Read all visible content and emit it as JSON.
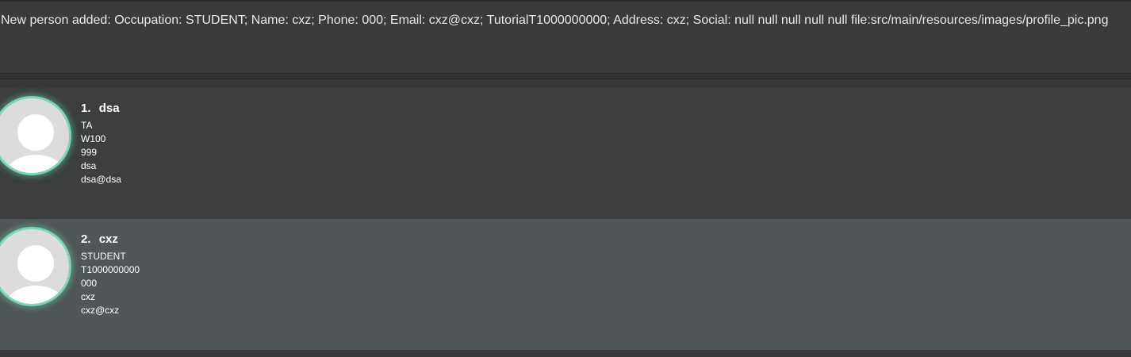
{
  "result_display": {
    "message": "New person added: Occupation: STUDENT; Name: cxz; Phone: 000; Email: cxz@cxz; TutorialT1000000000; Address: cxz; Social: null null null null null file:src/main/resources/images/profile_pic.png"
  },
  "persons": [
    {
      "index": "1.",
      "name": "dsa",
      "occupation": "TA",
      "tutorial": "W100",
      "phone": "999",
      "address": "dsa",
      "email": "dsa@dsa",
      "avatar_icon": "default-profile-icon"
    },
    {
      "index": "2.",
      "name": "cxz",
      "occupation": "STUDENT",
      "tutorial": "T1000000000",
      "phone": "000",
      "address": "cxz",
      "email": "cxz@cxz",
      "avatar_icon": "default-profile-icon"
    }
  ],
  "colors": {
    "background": "#383838",
    "card_odd": "#3c3e3f",
    "card_even": "#515658",
    "avatar_ring": "#7bd6b5",
    "text": "#ffffff"
  }
}
